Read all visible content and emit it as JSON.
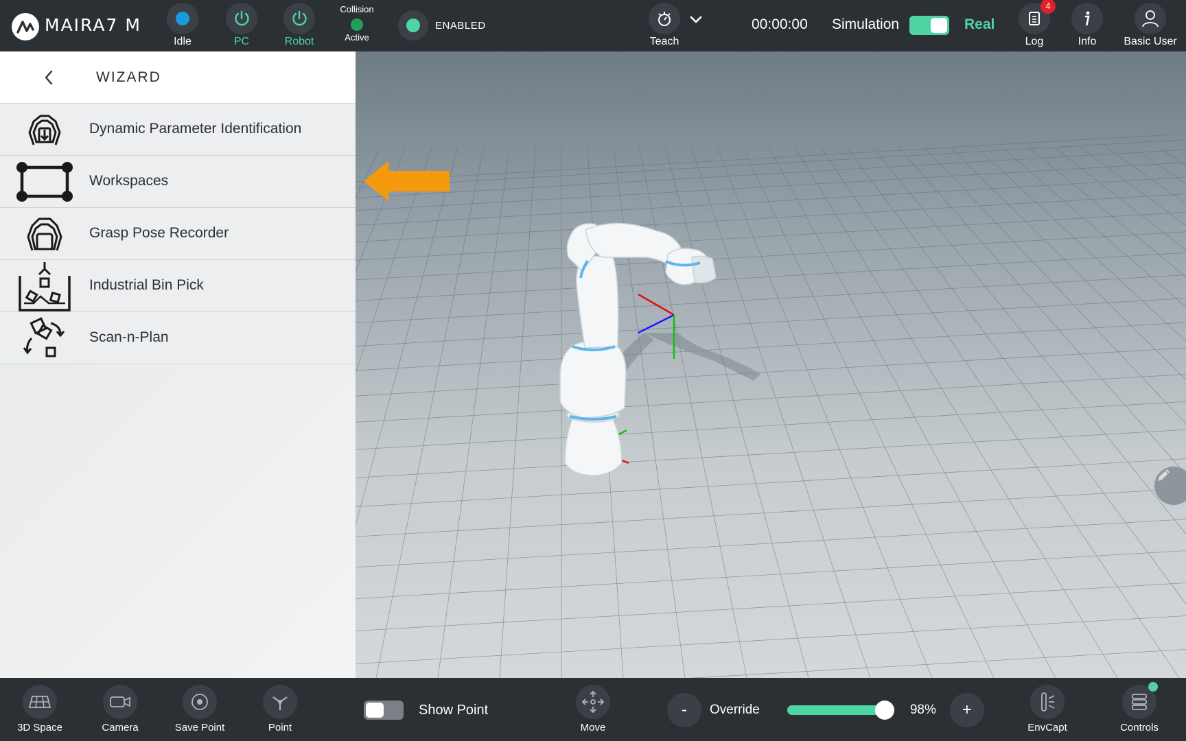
{
  "app": {
    "title": "MAIRA7 M"
  },
  "status": {
    "idle_label": "Idle",
    "pc_label": "PC",
    "robot_label": "Robot",
    "collision_label": "Collision",
    "collision_state": "Active",
    "enabled_label": "ENABLED",
    "teach_label": "Teach",
    "timer": "00:00:00",
    "simulation_label": "Simulation",
    "real_label": "Real",
    "log_label": "Log",
    "log_badge": "4",
    "info_label": "Info",
    "user_label": "Basic User"
  },
  "colors": {
    "accent": "#4fd4a4",
    "bar": "#2b3035",
    "arrow": "#f59a0c",
    "badge": "#e0202a",
    "idle_dot": "#1a9be0"
  },
  "wizard": {
    "title": "WIZARD",
    "items": [
      {
        "label": "Dynamic Parameter Identification",
        "icon": "gripper-download-icon"
      },
      {
        "label": "Workspaces",
        "icon": "workspace-frame-icon"
      },
      {
        "label": "Grasp Pose Recorder",
        "icon": "gripper-icon"
      },
      {
        "label": "Industrial Bin Pick",
        "icon": "bin-pick-icon"
      },
      {
        "label": "Scan-n-Plan",
        "icon": "scan-plan-icon"
      }
    ]
  },
  "bottom": {
    "space_label": "3D Space",
    "camera_label": "Camera",
    "save_point_label": "Save Point",
    "point_label": "Point",
    "show_point_label": "Show Point",
    "move_label": "Move",
    "override_label": "Override",
    "override_minus": "-",
    "override_plus": "+",
    "override_value": "98%",
    "override_fraction": 0.98,
    "envcapt_label": "EnvCapt",
    "controls_label": "Controls"
  }
}
